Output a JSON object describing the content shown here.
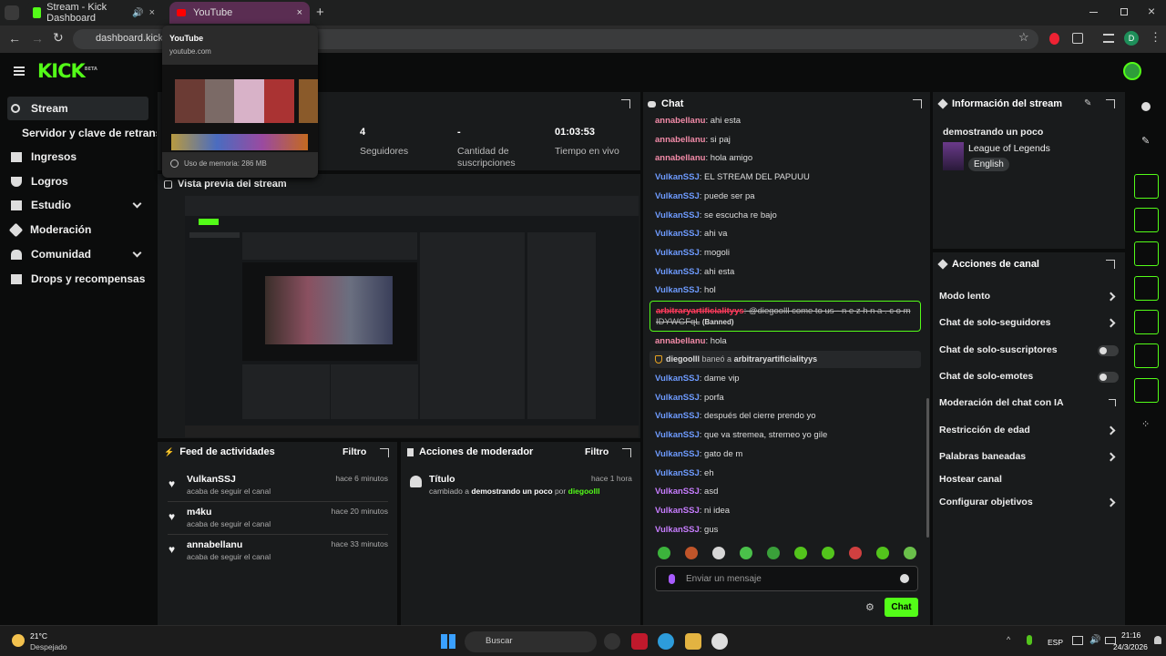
{
  "browser": {
    "tabs": [
      {
        "title": "Stream - Kick Dashboard",
        "active": false
      },
      {
        "title": "YouTube",
        "active": true
      }
    ],
    "address": "dashboard.kick.co",
    "hover_card": {
      "title": "YouTube",
      "url": "youtube.com",
      "memory": "Uso de memoria: 286 MB"
    },
    "profile_initial": "D"
  },
  "sidebar": {
    "items": [
      {
        "label": "Stream",
        "icon": "broadcast-icon",
        "active": true
      },
      {
        "label": "Servidor y clave de retransm",
        "icon": "",
        "sub": true
      },
      {
        "label": "Ingresos",
        "icon": "chart-icon"
      },
      {
        "label": "Logros",
        "icon": "trophy-icon"
      },
      {
        "label": "Estudio",
        "icon": "grid-icon",
        "expandable": true
      },
      {
        "label": "Moderación",
        "icon": "wrench-icon"
      },
      {
        "label": "Comunidad",
        "icon": "people-icon",
        "expandable": true
      },
      {
        "label": "Drops y recompensas",
        "icon": "gift-icon"
      }
    ]
  },
  "stats": [
    {
      "value": "4",
      "label": "Seguidores"
    },
    {
      "value": "-",
      "label": "Cantidad de suscripciones"
    },
    {
      "value": "01:03:53",
      "label": "Tiempo en vivo"
    }
  ],
  "preview": {
    "title": "Vista previa del stream"
  },
  "feed": {
    "title": "Feed de actividades",
    "filter": "Filtro",
    "items": [
      {
        "user": "VulkanSSJ",
        "action": "acaba de seguir el canal",
        "time": "hace 6 minutos"
      },
      {
        "user": "m4ku",
        "action": "acaba de seguir el canal",
        "time": "hace 20 minutos"
      },
      {
        "user": "annabellanu",
        "action": "acaba de seguir el canal",
        "time": "hace 33 minutos"
      }
    ]
  },
  "modactions": {
    "title": "Acciones de moderador",
    "filter": "Filtro",
    "item": {
      "title": "Título",
      "time": "hace 1 hora",
      "prefix": "cambiado a",
      "value": "demostrando un poco",
      "by": "por",
      "user": "diegoolll"
    }
  },
  "chat": {
    "title": "Chat",
    "messages": [
      {
        "user": "annabellanu",
        "color": "#f38ba8",
        "text": "ahi esta"
      },
      {
        "user": "annabellanu",
        "color": "#f38ba8",
        "text": "si paj"
      },
      {
        "user": "annabellanu",
        "color": "#f38ba8",
        "text": "hola amigo"
      },
      {
        "user": "VulkanSSJ",
        "color": "#6e9bff",
        "text": "EL STREAM DEL PAPUUU"
      },
      {
        "user": "VulkanSSJ",
        "color": "#6e9bff",
        "text": "puede ser pa"
      },
      {
        "user": "VulkanSSJ",
        "color": "#6e9bff",
        "text": "se escucha re bajo"
      },
      {
        "user": "VulkanSSJ",
        "color": "#6e9bff",
        "text": "ahi va"
      },
      {
        "user": "VulkanSSJ",
        "color": "#6e9bff",
        "text": "mogoli"
      },
      {
        "user": "VulkanSSJ",
        "color": "#6e9bff",
        "text": "ahi esta"
      },
      {
        "user": "VulkanSSJ",
        "color": "#6e9bff",
        "text": "hol"
      }
    ],
    "banned_msg": {
      "user": "arbitraryartificialityys",
      "text": "@diegoolll come to us - n e z h n a . c o m IDYWGFqL",
      "tag": "(Banned)"
    },
    "messages2": [
      {
        "user": "annabellanu",
        "color": "#f38ba8",
        "text": "hola"
      }
    ],
    "ban_notice": {
      "mod": "diegoolll",
      "text": "baneó a",
      "target": "arbitraryartificialityys"
    },
    "messages3": [
      {
        "user": "VulkanSSJ",
        "color": "#6e9bff",
        "text": "dame vip"
      },
      {
        "user": "VulkanSSJ",
        "color": "#6e9bff",
        "text": "porfa"
      },
      {
        "user": "VulkanSSJ",
        "color": "#6e9bff",
        "text": "después del cierre prendo yo"
      },
      {
        "user": "VulkanSSJ",
        "color": "#6e9bff",
        "text": "que va stremea, stremeo yo gile"
      },
      {
        "user": "VulkanSSJ",
        "color": "#6e9bff",
        "text": "gato de m"
      },
      {
        "user": "VulkanSSJ",
        "color": "#6e9bff",
        "text": "eh"
      },
      {
        "user": "VulkanSSJ",
        "color": "#c77dff",
        "text": "asd"
      },
      {
        "user": "VulkanSSJ",
        "color": "#c77dff",
        "text": "ni idea"
      },
      {
        "user": "VulkanSSJ",
        "color": "#c77dff",
        "text": "gus"
      }
    ],
    "input_placeholder": "Enviar un mensaje",
    "send_label": "Chat"
  },
  "info": {
    "title": "Información del stream",
    "stream_title": "demostrando un poco",
    "category": "League of Legends",
    "language": "English"
  },
  "channel_actions": {
    "title": "Acciones de canal",
    "items": [
      {
        "label": "Modo lento",
        "control": "chevron"
      },
      {
        "label": "Chat de solo-seguidores",
        "control": "chevron"
      },
      {
        "label": "Chat de solo-suscriptores",
        "control": "toggle"
      },
      {
        "label": "Chat de solo-emotes",
        "control": "toggle"
      },
      {
        "label": "Moderación del chat con IA",
        "control": "external"
      },
      {
        "label": "Restricción de edad",
        "control": "chevron"
      },
      {
        "label": "Palabras baneadas",
        "control": "chevron"
      },
      {
        "label": "Hostear canal",
        "control": "none"
      },
      {
        "label": "Configurar objetivos",
        "control": "chevron"
      }
    ]
  },
  "taskbar": {
    "weather_temp": "21°C",
    "weather_desc": "Despejado",
    "search": "Buscar",
    "lang": "ESP",
    "time": "21:16",
    "date": "24/3/2026"
  },
  "colors": {
    "accent": "#53fc18",
    "panel": "#191b1c",
    "bg": "#0b0c0c"
  }
}
